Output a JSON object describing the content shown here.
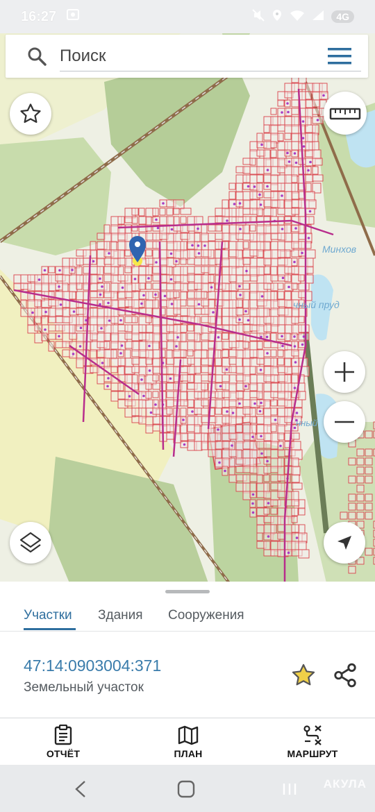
{
  "status_bar": {
    "time": "16:27",
    "network_badge": "4G"
  },
  "search": {
    "placeholder": "Поиск"
  },
  "map": {
    "labels": {
      "lake_1": "Минхов",
      "lake_2": "чный пруд",
      "lake_3": "нный"
    },
    "colors": {
      "parcel_stroke": "#d9424a",
      "road": "#b82d8c",
      "forest": "#b7cf9b",
      "field": "#efefbd",
      "water": "#bfe3f2"
    }
  },
  "sheet": {
    "tabs": [
      {
        "label": "Участки",
        "active": true
      },
      {
        "label": "Здания",
        "active": false
      },
      {
        "label": "Сооружения",
        "active": false
      }
    ],
    "parcel": {
      "number": "47:14:0903004:371",
      "type": "Земельный участок"
    }
  },
  "bottom_nav": {
    "items": [
      {
        "label": "ОТЧЁТ",
        "icon": "report-icon"
      },
      {
        "label": "ПЛАН",
        "icon": "map-plan-icon"
      },
      {
        "label": "МАРШРУТ",
        "icon": "route-icon"
      }
    ]
  },
  "watermark": "АКУЛА"
}
